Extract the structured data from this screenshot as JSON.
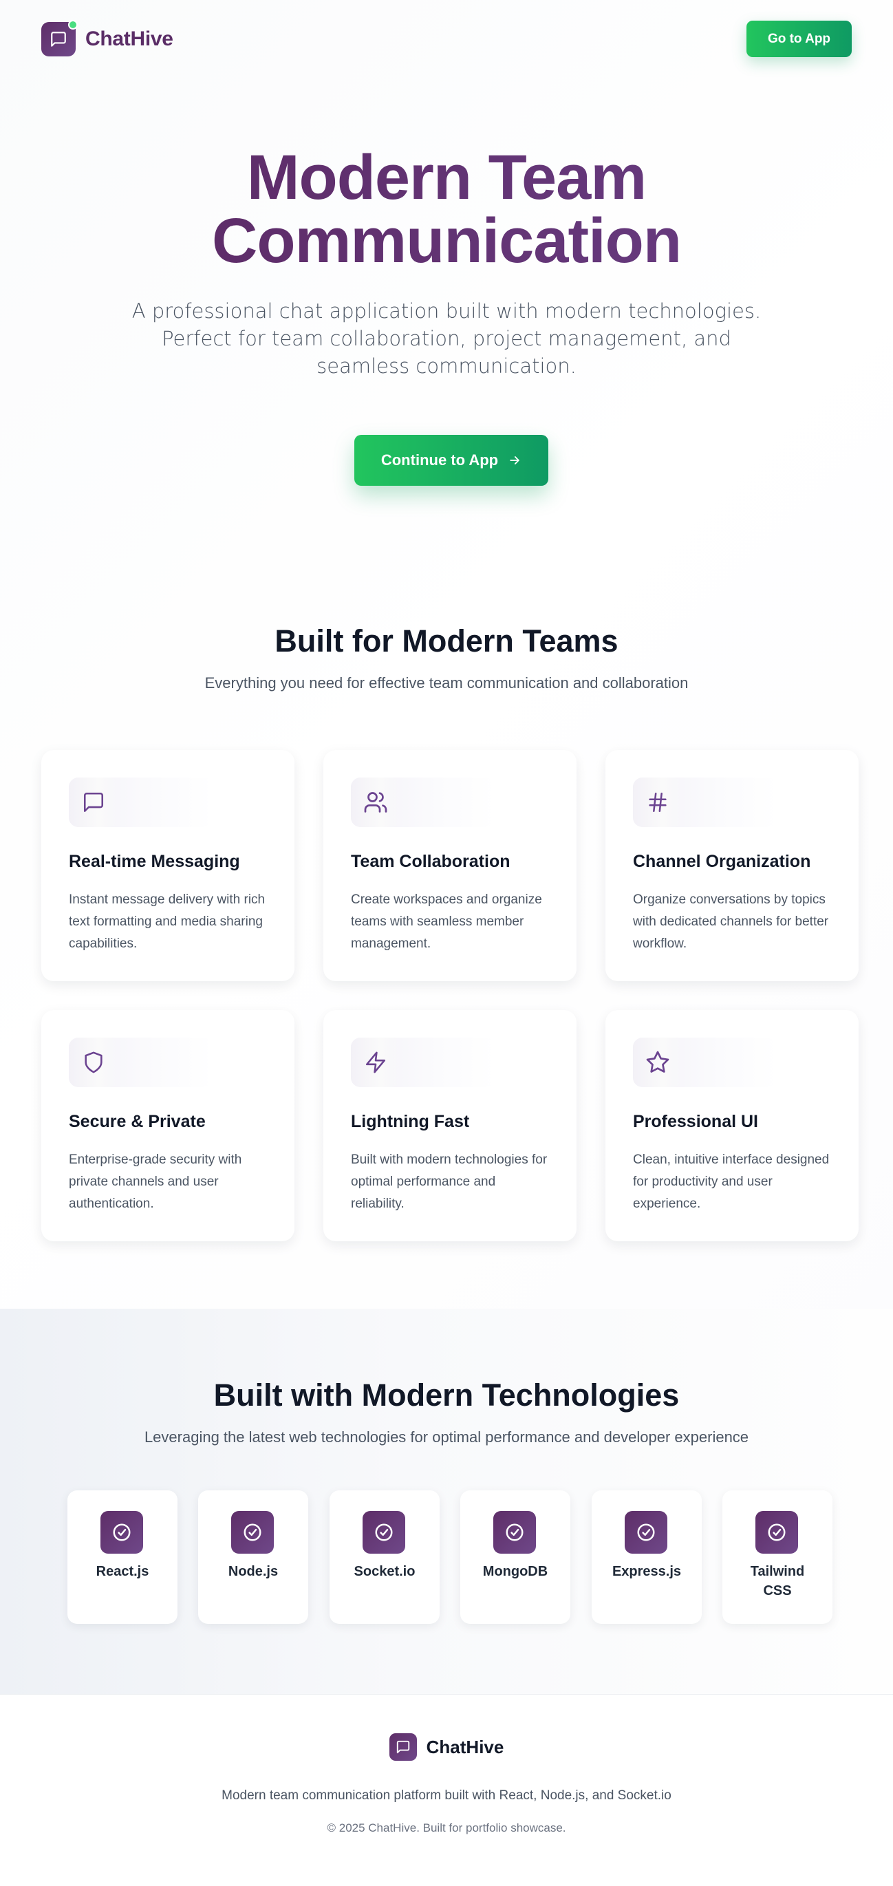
{
  "brand": {
    "name": "ChatHive",
    "accent": "#5a2d66",
    "green": "#22c55e",
    "status_dot": "#4ade80",
    "logo_icon": "chat-bubble-icon"
  },
  "header": {
    "cta_label": "Go to App"
  },
  "hero": {
    "title_line1": "Modern Team",
    "title_line2": "Communication",
    "subtitle": "A professional chat application built with modern technologies. Perfect for team collaboration, project management, and seamless communication.",
    "cta_label": "Continue to App",
    "cta_icon": "arrow-right-icon"
  },
  "features": {
    "title": "Built for Modern Teams",
    "subtitle": "Everything you need for effective team communication and collaboration",
    "items": [
      {
        "icon": "message-square-icon",
        "title": "Real-time Messaging",
        "desc": "Instant message delivery with rich text formatting and media sharing capabilities."
      },
      {
        "icon": "users-icon",
        "title": "Team Collaboration",
        "desc": "Create workspaces and organize teams with seamless member management."
      },
      {
        "icon": "hash-icon",
        "title": "Channel Organization",
        "desc": "Organize conversations by topics with dedicated channels for better workflow."
      },
      {
        "icon": "shield-icon",
        "title": "Secure & Private",
        "desc": "Enterprise-grade security with private channels and user authentication."
      },
      {
        "icon": "zap-icon",
        "title": "Lightning Fast",
        "desc": "Built with modern technologies for optimal performance and reliability."
      },
      {
        "icon": "star-icon",
        "title": "Professional UI",
        "desc": "Clean, intuitive interface designed for productivity and user experience."
      }
    ]
  },
  "tech": {
    "title": "Built with Modern Technologies",
    "subtitle": "Leveraging the latest web technologies for optimal performance and developer experience",
    "items": [
      {
        "icon": "check-circle-icon",
        "label": "React.js"
      },
      {
        "icon": "check-circle-icon",
        "label": "Node.js"
      },
      {
        "icon": "check-circle-icon",
        "label": "Socket.io"
      },
      {
        "icon": "check-circle-icon",
        "label": "MongoDB"
      },
      {
        "icon": "check-circle-icon",
        "label": "Express.js"
      },
      {
        "icon": "check-circle-icon",
        "label": "Tailwind CSS"
      }
    ]
  },
  "footer": {
    "brand": "ChatHive",
    "description": "Modern team communication platform built with React, Node.js, and Socket.io",
    "copyright": "© 2025 ChatHive. Built for portfolio showcase."
  }
}
